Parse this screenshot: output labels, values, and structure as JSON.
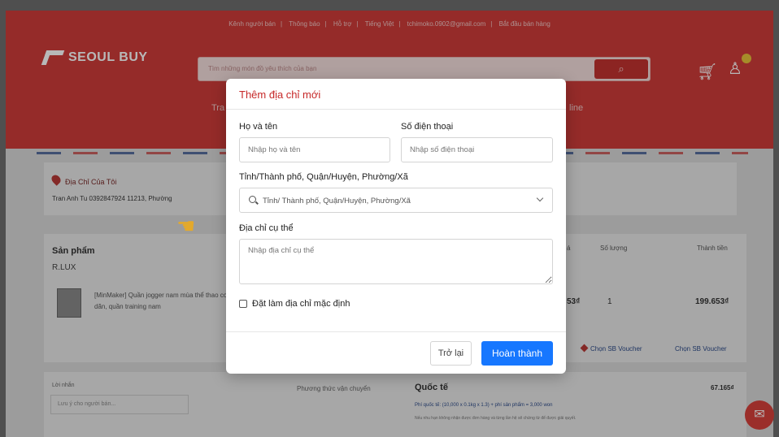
{
  "topbar": {
    "items": [
      "Kênh người bán",
      "Thông báo",
      "Hỗ trợ",
      "Tiếng Việt",
      "tchimoko.0902@gmail.com",
      "Bắt đầu bán hàng"
    ]
  },
  "header": {
    "logo": "SEOUL BUY",
    "search_placeholder": "Tìm những món đồ yêu thích của bạn",
    "nav_left": "Tra",
    "nav_right": "line"
  },
  "address": {
    "title": "Địa Chỉ Của Tôi",
    "line": "Tran Anh Tu 0392847924   11213, Phường"
  },
  "products": {
    "section_title": "Sản phẩm",
    "shop": "R.LUX",
    "columns": {
      "price_frag": "á",
      "qty": "Số lượng",
      "total": "Thành tiền"
    },
    "item": {
      "name": "[MinMaker] Quần jogger nam mùa thể thao co dãn, quần training nam",
      "price_frag": "53₫",
      "qty": "1",
      "total": "199.653₫"
    },
    "voucher_left": "Chọn SB Voucher",
    "voucher_right": "Chọn SB Voucher"
  },
  "footer_section": {
    "note_label": "Lời nhắn",
    "note_placeholder": "Lưu ý cho người bán...",
    "shipping_label": "Phương thức vận chuyển",
    "shipping_value": "Quốc tế",
    "shipping_fee": "67.165₫",
    "shipping_desc": "Phí quốc tế: (10,000 x 0.1kg x 1.3) + phí sản phẩm = 3,000 won",
    "shipping_desc2": "Nếu nhu hạn không nhận được đơn hàng và từng lần hệ sẽ chứng từ để được giải quyết."
  },
  "modal": {
    "title": "Thêm địa chỉ mới",
    "fullname": {
      "label": "Họ và tên",
      "placeholder": "Nhập họ và tên"
    },
    "phone": {
      "label": "Số điện thoại",
      "placeholder": "Nhập số điện thoại"
    },
    "region": {
      "label": "Tỉnh/Thành phố, Quận/Huyện, Phường/Xã",
      "placeholder": "Tỉnh/ Thành phố, Quận/Huyện, Phường/Xã"
    },
    "detail": {
      "label": "Địa chỉ cụ thể",
      "placeholder": "Nhập địa chỉ cụ thể"
    },
    "default_checkbox": "Đặt làm địa chỉ mặc định",
    "back_button": "Trở lại",
    "done_button": "Hoàn thành"
  },
  "colors": {
    "brand_red": "#cf3c3a",
    "modal_title": "#c62828",
    "primary_blue": "#1677ff"
  },
  "icons": [
    "search-icon",
    "cart-icon",
    "user-icon",
    "location-pin-icon",
    "pointing-hand-icon",
    "chat-fab-icon",
    "chevron-down-icon"
  ]
}
